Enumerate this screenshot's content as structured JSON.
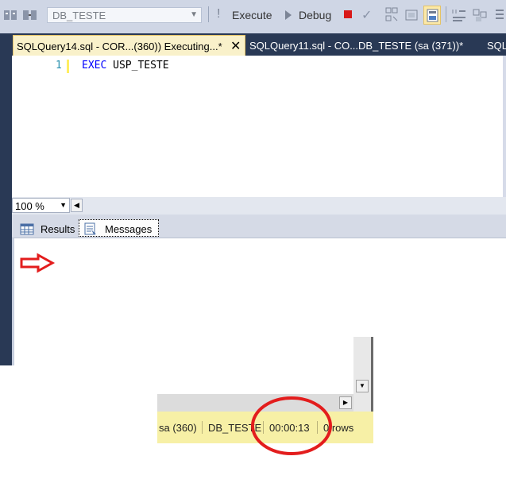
{
  "toolbar": {
    "database_value": "DB_TESTE",
    "execute_label": "Execute",
    "debug_label": "Debug"
  },
  "tabs": {
    "active_label": "SQLQuery14.sql - COR...(360)) Executing...*",
    "inactive_label": "SQLQuery11.sql - CO...DB_TESTE (sa (371))*",
    "overflow_label": "SQL"
  },
  "editor": {
    "line_number": "1",
    "keyword": "EXEC",
    "code_rest": " USP_TESTE"
  },
  "zoom": {
    "value": "100 %"
  },
  "result_tabs": {
    "results_label": "Results",
    "messages_label": "Messages"
  },
  "status_bar": {
    "user": "sa (360)",
    "database": "DB_TESTE",
    "elapsed": "00:00:13",
    "rows": "0 rows"
  },
  "colors": {
    "annotation": "#e31d1d",
    "tab_active_bg": "#f9f1ca",
    "ide_dark": "#293955",
    "status_bar_bg": "#f7f0a6"
  }
}
